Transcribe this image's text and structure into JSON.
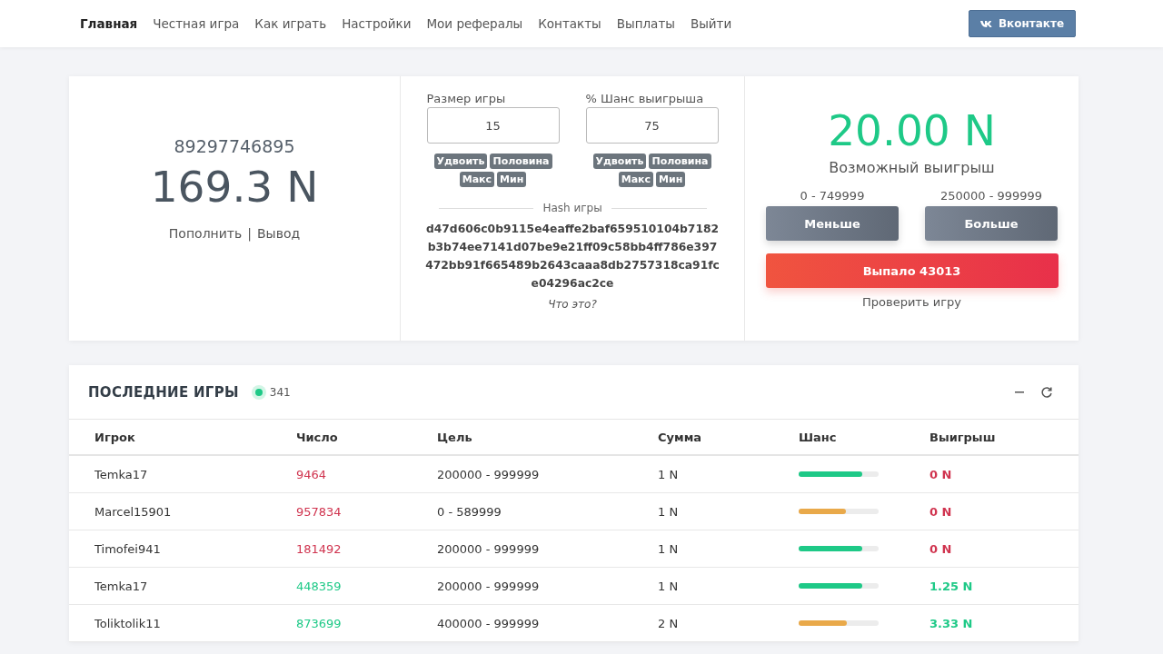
{
  "nav": {
    "items": [
      {
        "label": "Главная",
        "selected": true
      },
      {
        "label": "Честная игра",
        "selected": false
      },
      {
        "label": "Как играть",
        "selected": false
      },
      {
        "label": "Настройки",
        "selected": false
      },
      {
        "label": "Мои рефералы",
        "selected": false
      },
      {
        "label": "Контакты",
        "selected": false
      },
      {
        "label": "Выплаты",
        "selected": false
      },
      {
        "label": "Выйти",
        "selected": false
      }
    ],
    "social_button": "Вконтакте"
  },
  "account": {
    "id": "89297746895",
    "balance": "169.3 N",
    "deposit": "Пополнить",
    "separator": "|",
    "withdraw": "Вывод"
  },
  "bet": {
    "fields": [
      {
        "label": "Размер игры",
        "value": "15",
        "buttons": [
          "Удвоить",
          "Половина",
          "Макс",
          "Мин"
        ]
      },
      {
        "label": "% Шанс выигрыша",
        "value": "75",
        "buttons": [
          "Удвоить",
          "Половина",
          "Макс",
          "Мин"
        ]
      }
    ],
    "hash_label": "Hash игры",
    "hash": "d47d606c0b9115e4eaffe2baf659510104b7182b3b74ee7141d07be9e21ff09c58bb4ff786e397472bb91f665489b2643caaa8db2757318ca91fce04296ac2ce",
    "hash_help": "Что это?"
  },
  "result": {
    "payout": "20.00 N",
    "payout_label": "Возможный выигрыш",
    "ranges": [
      {
        "range": "0 - 749999",
        "button": "Меньше"
      },
      {
        "range": "250000 - 999999",
        "button": "Больше"
      }
    ],
    "outcome": "Выпало 43013",
    "verify": "Проверить игру"
  },
  "games": {
    "title": "ПОСЛЕДНИЕ ИГРЫ",
    "online": "341",
    "columns": [
      "Игрок",
      "Число",
      "Цель",
      "Сумма",
      "Шанс",
      "Выигрыш"
    ],
    "rows": [
      {
        "player": "Temka17",
        "number": "9464",
        "target": "200000 - 999999",
        "amount": "1 N",
        "level": 0.8,
        "color": "#1ec987",
        "win": false,
        "payout": "0 N"
      },
      {
        "player": "Marcel15901",
        "number": "957834",
        "target": "0 - 589999",
        "amount": "1 N",
        "level": 0.59,
        "color": "#e9a94a",
        "win": false,
        "payout": "0 N"
      },
      {
        "player": "Timofei941",
        "number": "181492",
        "target": "200000 - 999999",
        "amount": "1 N",
        "level": 0.8,
        "color": "#1ec987",
        "win": false,
        "payout": "0 N"
      },
      {
        "player": "Temka17",
        "number": "448359",
        "target": "200000 - 999999",
        "amount": "1 N",
        "level": 0.8,
        "color": "#1ec987",
        "win": true,
        "payout": "1.25 N"
      },
      {
        "player": "Toliktolik11",
        "number": "873699",
        "target": "400000 - 999999",
        "amount": "2 N",
        "level": 0.6,
        "color": "#e9a94a",
        "win": true,
        "payout": "3.33 N"
      }
    ]
  }
}
